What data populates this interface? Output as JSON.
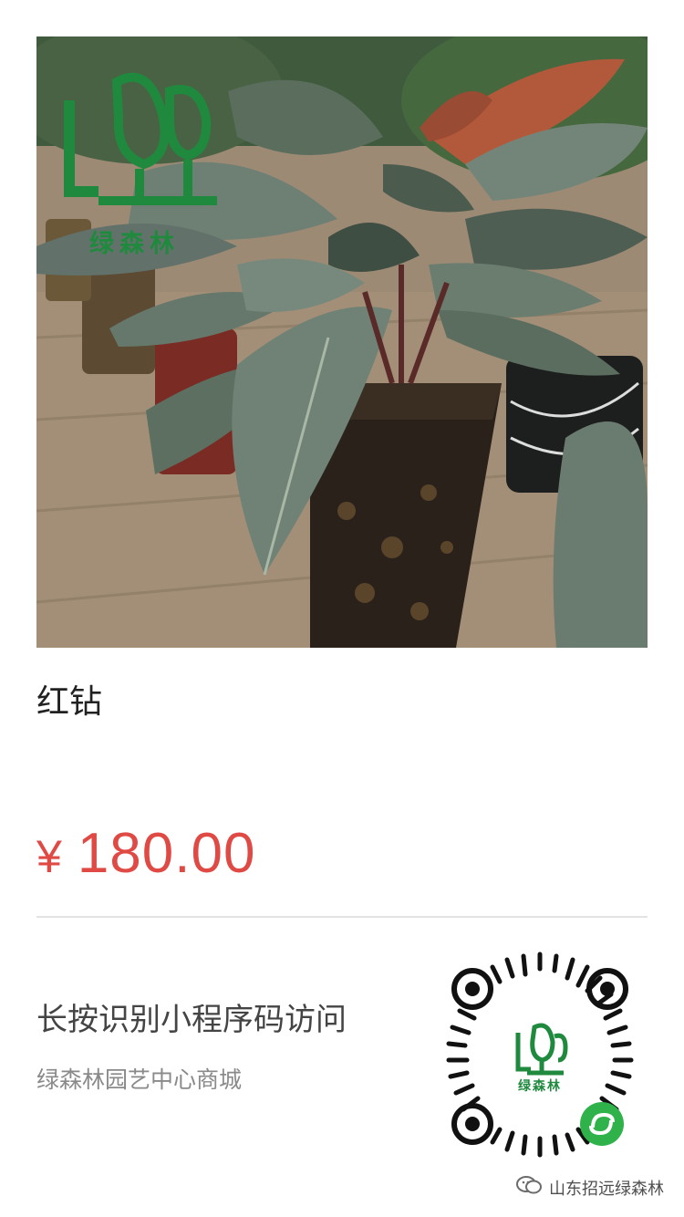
{
  "product": {
    "name": "红钻",
    "price_symbol": "¥",
    "price_value": "180.00"
  },
  "brand": {
    "logo_text": "绿森林",
    "qr_center_text": "绿森林"
  },
  "miniprogram": {
    "hint": "长按识别小程序码访问",
    "shop_name": "绿森林园艺中心商城"
  },
  "watermark": {
    "text": "山东招远绿森林",
    "icon": "wechat-icon"
  },
  "colors": {
    "price": "#e04a45",
    "brand_green": "#1f8a3e",
    "divider": "#e3e3e3"
  }
}
